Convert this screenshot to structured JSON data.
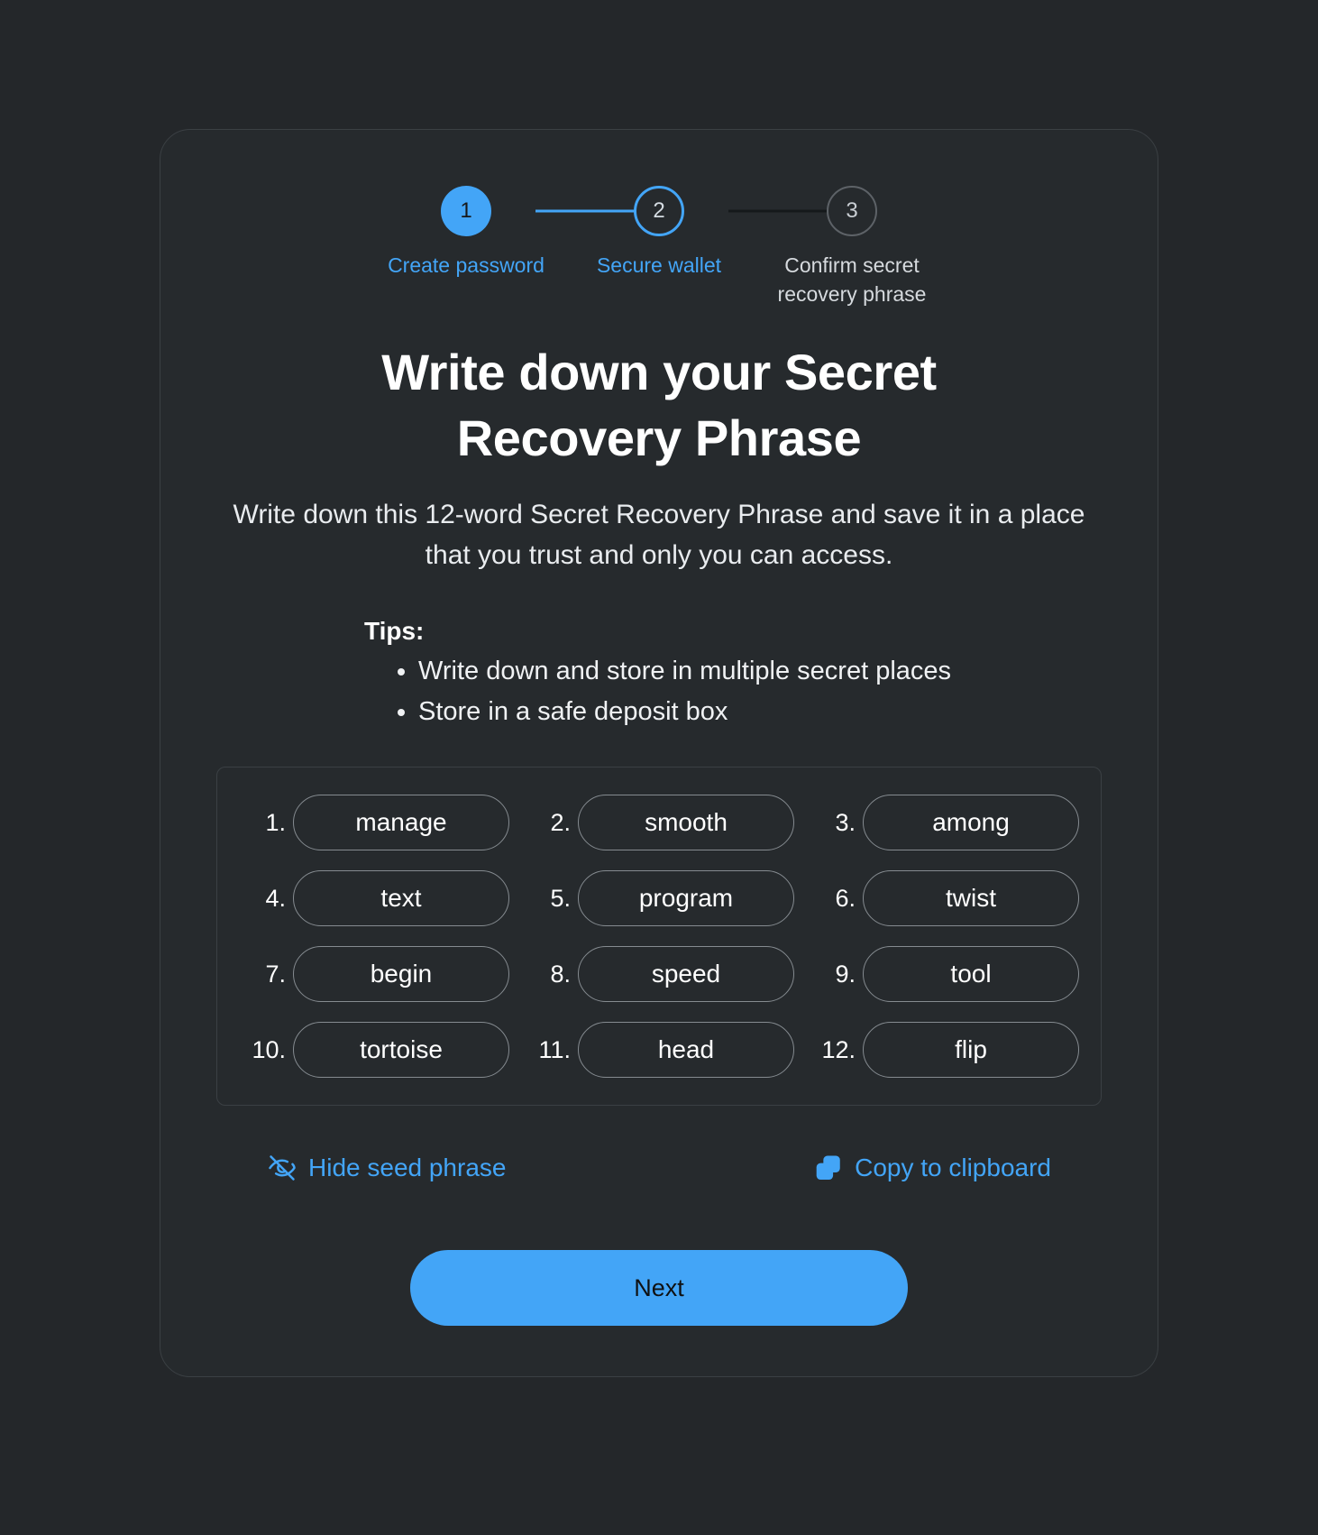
{
  "theme": {
    "page_background": "#24272a",
    "card_background": "#262a2d",
    "accent": "#43a5f7",
    "text_primary": "#ffffff",
    "border": "#3b4044"
  },
  "stepper": {
    "steps": [
      {
        "number": "1",
        "label": "Create password",
        "state": "complete"
      },
      {
        "number": "2",
        "label": "Secure wallet",
        "state": "active"
      },
      {
        "number": "3",
        "label": "Confirm secret recovery phrase",
        "state": "upcoming"
      }
    ]
  },
  "heading": {
    "title": "Write down your Secret Recovery Phrase",
    "subtitle": "Write down this 12-word Secret Recovery Phrase and save it in a place that you trust and only you can access."
  },
  "tips": {
    "title": "Tips:",
    "items": [
      "Write down and store in multiple secret places",
      "Store in a safe deposit box"
    ]
  },
  "seed_phrase": {
    "words": [
      {
        "index": "1.",
        "word": "manage"
      },
      {
        "index": "2.",
        "word": "smooth"
      },
      {
        "index": "3.",
        "word": "among"
      },
      {
        "index": "4.",
        "word": "text"
      },
      {
        "index": "5.",
        "word": "program"
      },
      {
        "index": "6.",
        "word": "twist"
      },
      {
        "index": "7.",
        "word": "begin"
      },
      {
        "index": "8.",
        "word": "speed"
      },
      {
        "index": "9.",
        "word": "tool"
      },
      {
        "index": "10.",
        "word": "tortoise"
      },
      {
        "index": "11.",
        "word": "head"
      },
      {
        "index": "12.",
        "word": "flip"
      }
    ]
  },
  "actions": {
    "hide": {
      "label": "Hide seed phrase",
      "icon": "eye-off-icon"
    },
    "copy": {
      "label": "Copy to clipboard",
      "icon": "copy-icon"
    }
  },
  "footer": {
    "next_label": "Next"
  }
}
